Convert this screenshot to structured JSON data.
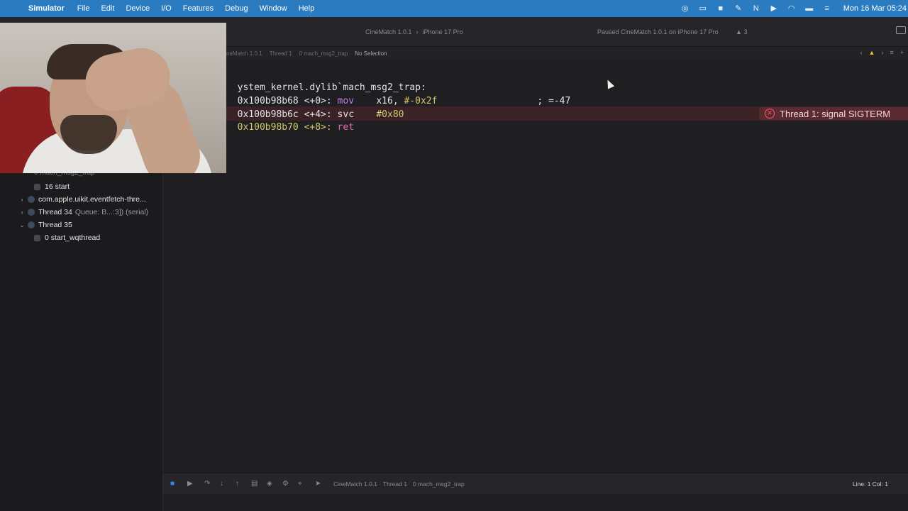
{
  "menubar": {
    "app_name": "Simulator",
    "items": [
      "File",
      "Edit",
      "Device",
      "I/O",
      "Features",
      "Debug",
      "Window",
      "Help"
    ],
    "clock": "Mon 16 Mar 05:24"
  },
  "toolbar": {
    "scheme": "CineMatch 1.0.1",
    "destination": "iPhone 17 Pro",
    "activity": "Paused CineMatch 1.0.1 on iPhone 17 Pro",
    "warnings": "3"
  },
  "jumpbar": {
    "crumbs": [
      "neMatch 1.0.1",
      "Thread 1",
      "0 mach_msg2_trap",
      "No Selection"
    ]
  },
  "navigator": {
    "hidden_row": "0 mach_msg2_trap",
    "rows": [
      {
        "label": "16 start",
        "kind": "frame"
      },
      {
        "label": "com.apple.uikit.eventfetch-thre...",
        "kind": "thread",
        "expanded": false
      },
      {
        "label": "Thread 34",
        "detail": "Queue: B...:3]) (serial)",
        "kind": "thread",
        "expanded": false
      },
      {
        "label": "Thread 35",
        "kind": "thread",
        "expanded": true
      },
      {
        "label": "0 start_wqthread",
        "kind": "frame"
      }
    ]
  },
  "code": {
    "header": "ystem_kernel.dylib`mach_msg2_trap:",
    "lines": [
      {
        "addr": "0x100b98b68 <+0>:",
        "op": "mov",
        "args": "x16, ",
        "imm": "#-0x2f",
        "comment": "; =-47"
      },
      {
        "addr": "0x100b98b6c <+4>:",
        "op": "svc",
        "args": "",
        "imm": "#0x80",
        "comment": ""
      },
      {
        "addr": "0x100b98b70 <+8>:",
        "op": "ret",
        "args": "",
        "imm": "",
        "comment": ""
      }
    ],
    "error_badge": "Thread 1: signal SIGTERM"
  },
  "debugbar": {
    "crumbs": [
      "CineMatch 1.0.1",
      "Thread 1",
      "0 mach_msg2_trap"
    ],
    "linecol": "Line: 1  Col: 1"
  },
  "colors": {
    "menubar": "#2a7bbf",
    "error_line": "#3b2226",
    "opcode": "#c27ee8",
    "ret": "#ee6aa8",
    "immediate": "#d4c86a"
  }
}
